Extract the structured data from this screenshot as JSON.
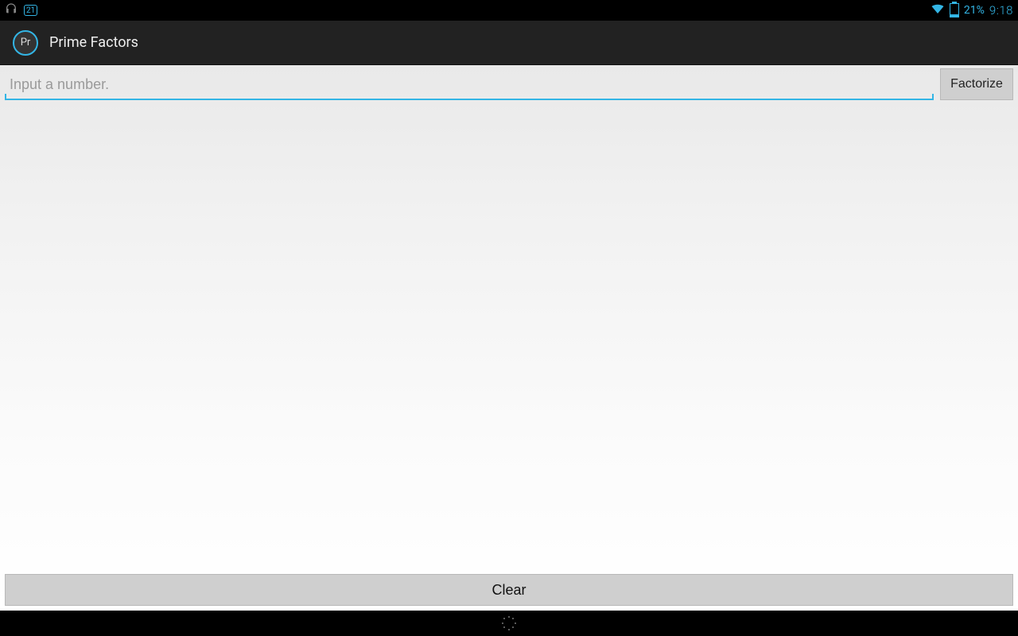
{
  "status": {
    "notification_badge": "21",
    "battery_pct": "21%",
    "clock": "9:18"
  },
  "app": {
    "icon_label": "Pr",
    "title": "Prime Factors"
  },
  "input": {
    "placeholder": "Input a number.",
    "value": ""
  },
  "buttons": {
    "factorize": "Factorize",
    "clear": "Clear"
  }
}
